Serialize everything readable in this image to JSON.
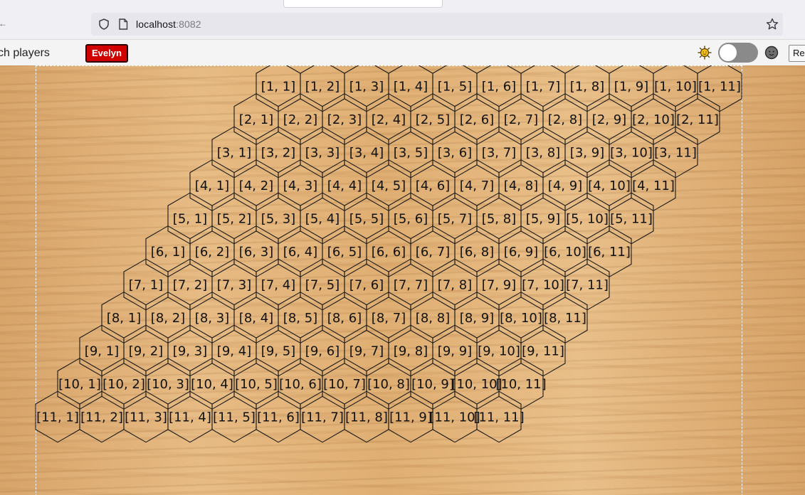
{
  "browser": {
    "url_host": "localhost",
    "url_port": ":8082",
    "icons": {
      "shield": "shield-icon",
      "page": "page-icon",
      "star": "bookmark-star-icon"
    }
  },
  "appbar": {
    "watch_label": "ch players",
    "player_name": "Evelyn",
    "player_color": "#d10000",
    "reset_label": "Re",
    "icons": {
      "light": "sun-icon",
      "dark": "moon-icon"
    }
  },
  "board": {
    "rows": 11,
    "cols": 11,
    "cell_labels": [
      [
        "[1, 1]",
        "[1, 2]",
        "[1, 3]",
        "[1, 4]",
        "[1, 5]",
        "[1, 6]",
        "[1, 7]",
        "[1, 8]",
        "[1, 9]",
        "[1, 10]",
        "[1, 11]"
      ],
      [
        "[2, 1]",
        "[2, 2]",
        "[2, 3]",
        "[2, 4]",
        "[2, 5]",
        "[2, 6]",
        "[2, 7]",
        "[2, 8]",
        "[2, 9]",
        "[2, 10]",
        "[2, 11]"
      ],
      [
        "[3, 1]",
        "[3, 2]",
        "[3, 3]",
        "[3, 4]",
        "[3, 5]",
        "[3, 6]",
        "[3, 7]",
        "[3, 8]",
        "[3, 9]",
        "[3, 10]",
        "[3, 11]"
      ],
      [
        "[4, 1]",
        "[4, 2]",
        "[4, 3]",
        "[4, 4]",
        "[4, 5]",
        "[4, 6]",
        "[4, 7]",
        "[4, 8]",
        "[4, 9]",
        "[4, 10]",
        "[4, 11]"
      ],
      [
        "[5, 1]",
        "[5, 2]",
        "[5, 3]",
        "[5, 4]",
        "[5, 5]",
        "[5, 6]",
        "[5, 7]",
        "[5, 8]",
        "[5, 9]",
        "[5, 10]",
        "[5, 11]"
      ],
      [
        "[6, 1]",
        "[6, 2]",
        "[6, 3]",
        "[6, 4]",
        "[6, 5]",
        "[6, 6]",
        "[6, 7]",
        "[6, 8]",
        "[6, 9]",
        "[6, 10]",
        "[6, 11]"
      ],
      [
        "[7, 1]",
        "[7, 2]",
        "[7, 3]",
        "[7, 4]",
        "[7, 5]",
        "[7, 6]",
        "[7, 7]",
        "[7, 8]",
        "[7, 9]",
        "[7, 10]",
        "[7, 11]"
      ],
      [
        "[8, 1]",
        "[8, 2]",
        "[8, 3]",
        "[8, 4]",
        "[8, 5]",
        "[8, 6]",
        "[8, 7]",
        "[8, 8]",
        "[8, 9]",
        "[8, 10]",
        "[8, 11]"
      ],
      [
        "[9, 1]",
        "[9, 2]",
        "[9, 3]",
        "[9, 4]",
        "[9, 5]",
        "[9, 6]",
        "[9, 7]",
        "[9, 8]",
        "[9, 9]",
        "[9, 10]",
        "[9, 11]"
      ],
      [
        "[10, 1]",
        "[10, 2]",
        "[10, 3]",
        "[10, 4]",
        "[10, 5]",
        "[10, 6]",
        "[10, 7]",
        "[10, 8]",
        "[10, 9]",
        "[10, 10]",
        "[10, 11]"
      ],
      [
        "[11, 1]",
        "[11, 2]",
        "[11, 3]",
        "[11, 4]",
        "[11, 5]",
        "[11, 6]",
        "[11, 7]",
        "[11, 8]",
        "[11, 9]",
        "[11, 10]",
        "[11, 11]"
      ]
    ]
  }
}
